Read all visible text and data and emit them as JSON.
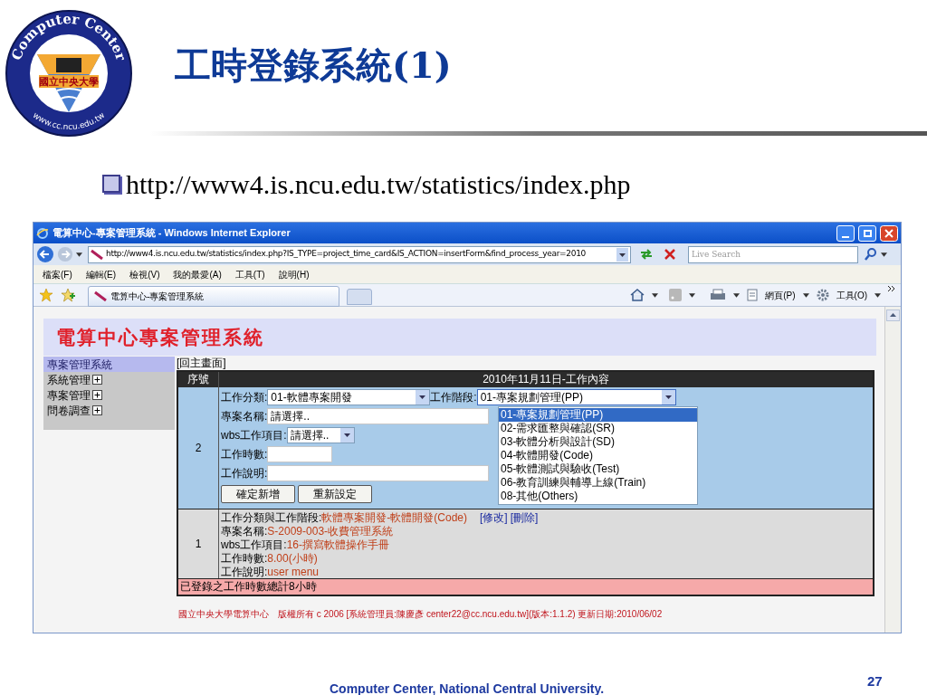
{
  "slide": {
    "logo": {
      "ring_top": "Computer Center",
      "ring_bottom": "www.cc.ncu.edu.tw",
      "center": "國立中央大學"
    },
    "title": "工時登錄系統(1)",
    "bullet": "http://www4.is.ncu.edu.tw/statistics/index.php"
  },
  "browser": {
    "title": "電算中心-專案管理系統 - Windows Internet Explorer",
    "address": "http://www4.is.ncu.edu.tw/statistics/index.php?IS_TYPE=project_time_card&IS_ACTION=insertForm&find_process_year=2010",
    "search_placeholder": "Live Search",
    "menu": [
      "檔案(F)",
      "編輯(E)",
      "檢視(V)",
      "我的最愛(A)",
      "工具(T)",
      "說明(H)"
    ],
    "tab": "電算中心-專案管理系統",
    "toolbar": [
      "網頁(P)",
      "工具(O)"
    ]
  },
  "page": {
    "site_title": "電算中心專案管理系統",
    "sidebar": [
      {
        "label": "專案管理系統",
        "selected": true,
        "expandable": false
      },
      {
        "label": "系統管理",
        "selected": false,
        "expandable": true
      },
      {
        "label": "專案管理",
        "selected": false,
        "expandable": true
      },
      {
        "label": "問卷調查",
        "selected": false,
        "expandable": true
      }
    ],
    "back_link": "[回主畫面]",
    "table": {
      "columns": [
        "序號",
        "2010年11月11日-工作內容"
      ],
      "form_row": {
        "number": "2",
        "lines": [
          {
            "fields": [
              {
                "kind": "select",
                "label": "工作分類:",
                "value": "01-軟體專案開發",
                "expanded": false
              },
              {
                "kind": "select",
                "label": "工作階段:",
                "value": "01-專案規劃管理(PP)",
                "expanded": true,
                "options": [
                  {
                    "label": "01-專案規劃管理(PP)",
                    "selected": true
                  },
                  {
                    "label": "02-需求匯整與確認(SR)",
                    "selected": false
                  },
                  {
                    "label": "03-軟體分析與設計(SD)",
                    "selected": false
                  },
                  {
                    "label": "04-軟體開發(Code)",
                    "selected": false
                  },
                  {
                    "label": "05-軟體測試與驗收(Test)",
                    "selected": false
                  },
                  {
                    "label": "06-教育訓練與輔導上線(Train)",
                    "selected": false
                  },
                  {
                    "label": "08-其他(Others)",
                    "selected": false
                  }
                ]
              }
            ]
          },
          {
            "fields": [
              {
                "kind": "text",
                "label": "專案名稱:",
                "value": "請選擇.."
              }
            ]
          },
          {
            "fields": [
              {
                "kind": "select",
                "label": "wbs工作項目:",
                "value": "請選擇..",
                "expanded": false
              }
            ]
          },
          {
            "fields": [
              {
                "kind": "text",
                "label": "工作時數:"
              }
            ]
          },
          {
            "fields": [
              {
                "kind": "text",
                "label": "工作說明:"
              }
            ]
          }
        ],
        "buttons": [
          "確定新增",
          "重新設定"
        ]
      },
      "record_row": {
        "number": "1",
        "lines": [
          {
            "label": "工作分類與工作階段:",
            "value": "軟體專案開發-軟體開發(Code)",
            "links": [
              "[修改]",
              "[刪除]"
            ]
          },
          {
            "label": "專案名稱:",
            "value": "S-2009-003-收費管理系統"
          },
          {
            "label": "wbs工作項目:",
            "value": "16-撰寫軟體操作手冊"
          },
          {
            "label": "工作時數:",
            "value": "8.00(小時)"
          },
          {
            "label": "工作說明:",
            "value": "user menu"
          }
        ]
      },
      "total": "已登錄之工作時數總計8小時"
    },
    "footer": "國立中央大學電算中心　版權所有 c 2006 [系統管理員:陳慶彥 center22@cc.ncu.edu.tw](版本:1.1.2) 更新日期:2010/06/02"
  },
  "footer": {
    "text": "Computer Center, National Central University.",
    "page_number": "27"
  }
}
